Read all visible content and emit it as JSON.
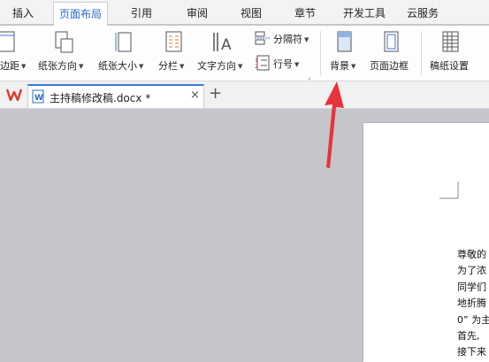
{
  "menu": {
    "tabs": [
      "插入",
      "页面布局",
      "引用",
      "审阅",
      "视图",
      "章节",
      "开发工具",
      "云服务"
    ],
    "active_tab": "页面布局"
  },
  "ribbon": {
    "margins": "边距",
    "orientation": "纸张方向",
    "size": "纸张大小",
    "columns": "分栏",
    "text_direction": "文字方向",
    "breaks": "分隔符",
    "line_numbers": "行号",
    "background": "背景",
    "page_border": "页面边框",
    "manuscript": "稿纸设置"
  },
  "doc_tab": {
    "filename": "主持稿修改稿.docx *",
    "close": "×",
    "new": "+"
  },
  "document": {
    "lines": [
      "尊敬的",
      "为了浓",
      "同学们",
      "地折腾",
      "0” 为主",
      "首先,",
      "接下来"
    ]
  },
  "colors": {
    "accent": "#2d6bc7",
    "arrow": "#e8323c",
    "wps_logo": "#d93a2e",
    "canvas": "#c4c6cc"
  }
}
